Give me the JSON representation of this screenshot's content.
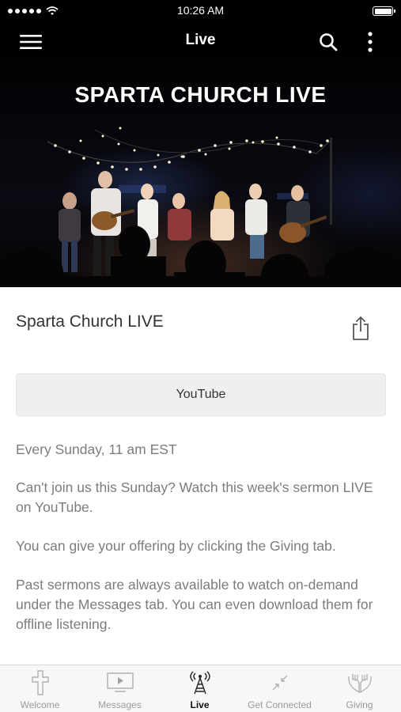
{
  "status_bar": {
    "time": "10:26 AM"
  },
  "nav": {
    "title": "Live"
  },
  "hero": {
    "title": "SPARTA CHURCH LIVE"
  },
  "content": {
    "title": "Sparta Church LIVE",
    "youtube_button": "YouTube",
    "paragraphs": [
      "Every Sunday, 11 am EST",
      "Can't join us this Sunday? Watch this week's sermon LIVE on YouTube.",
      "You can give your offering by clicking the Giving tab.",
      "Past sermons are always available to watch on-demand under the Messages tab. You can even download them for offline listening."
    ]
  },
  "tabs": [
    {
      "label": "Welcome",
      "icon": "cross-icon",
      "active": false
    },
    {
      "label": "Messages",
      "icon": "tv-play-icon",
      "active": false
    },
    {
      "label": "Live",
      "icon": "broadcast-tower-icon",
      "active": true
    },
    {
      "label": "Get Connected",
      "icon": "connect-arrows-icon",
      "active": false
    },
    {
      "label": "Giving",
      "icon": "hands-icon",
      "active": false
    }
  ],
  "colors": {
    "accent": "#000000",
    "inactive_tab": "#9a9a9a",
    "body_text": "#7c7c80"
  }
}
